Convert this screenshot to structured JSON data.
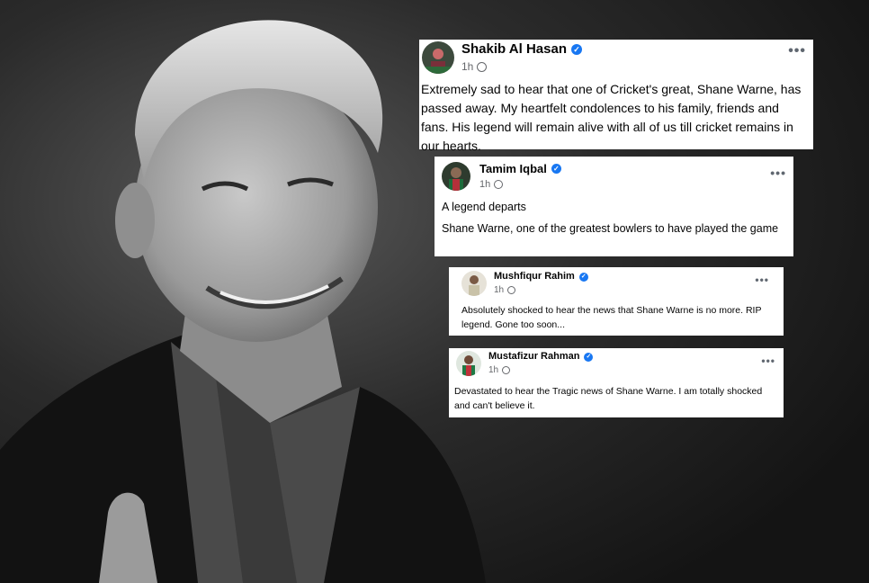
{
  "posts": [
    {
      "author": "Shakib Al Hasan",
      "time": "1h",
      "text": "Extremely sad to hear that one of Cricket's great, Shane Warne, has passed away. My heartfelt condolences to his family, friends and fans. His legend will remain alive with all of us till cricket remains in our hearts."
    },
    {
      "author": "Tamim Iqbal",
      "time": "1h",
      "text_lines": [
        "A legend departs",
        "Shane Warne, one of the greatest bowlers to have played the game"
      ]
    },
    {
      "author": "Mushfiqur Rahim",
      "time": "1h",
      "text": "Absolutely shocked to hear the news that Shane Warne is no more. RIP legend. Gone too soon..."
    },
    {
      "author": "Mustafizur Rahman",
      "time": "1h",
      "text": "Devastated to hear the Tragic news of  Shane Warne. I am totally shocked and can't believe it."
    }
  ],
  "icons": {
    "verified": "verified-badge-icon",
    "audience": "globe-icon",
    "more": "more-options-icon"
  },
  "colors": {
    "verified": "#1877f2",
    "meta_text": "#65676b",
    "post_bg": "#ffffff"
  }
}
